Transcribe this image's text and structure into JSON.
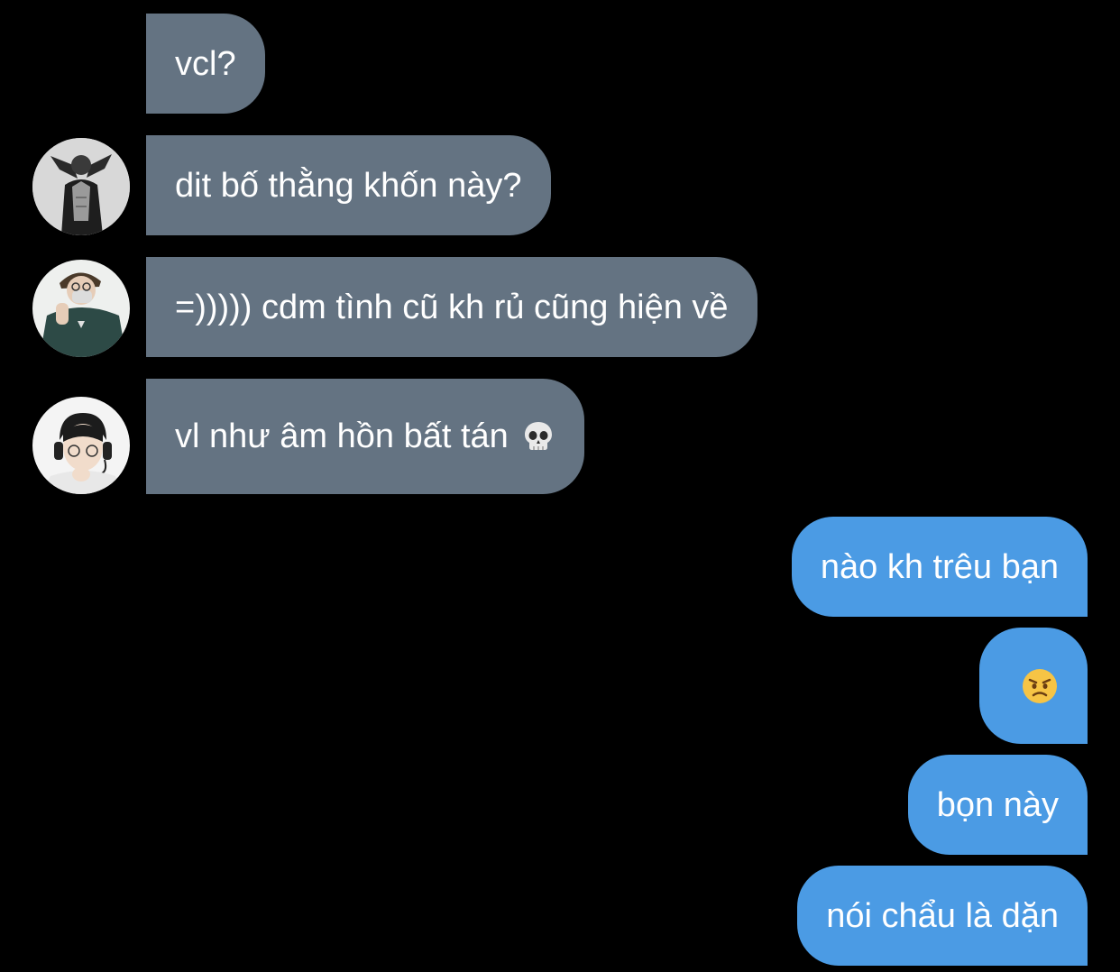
{
  "conversation": {
    "incoming": [
      {
        "text": "vcl?"
      },
      {
        "text": "dit bố thằng khốn này?"
      },
      {
        "text": "=))))) cdm tình cũ kh rủ cũng hiện về"
      },
      {
        "text": "vl như âm hồn bất tán",
        "emoji": "skull-emoji"
      }
    ],
    "outgoing": [
      {
        "text": "nào kh trêu bạn"
      },
      {
        "text": "",
        "emoji": "angry-face-emoji"
      },
      {
        "text": "bọn này"
      },
      {
        "text": "nói chẩu là dặn"
      }
    ]
  },
  "avatars": [
    {
      "icon": "avatar-person-icon",
      "style": "grayscale"
    },
    {
      "icon": "avatar-person-masked-icon",
      "style": "teal-jacket"
    },
    {
      "icon": "avatar-person-headset-icon",
      "style": "light"
    }
  ],
  "colors": {
    "background": "#000000",
    "incoming_bubble": "#647382",
    "outgoing_bubble": "#4b9be4",
    "text": "#ffffff"
  }
}
